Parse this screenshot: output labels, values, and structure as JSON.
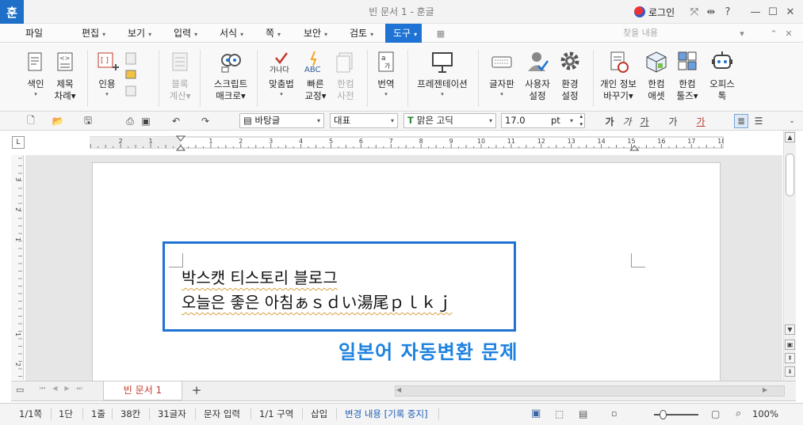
{
  "app": {
    "logo_text": "훈",
    "window_title": "빈 문서 1 - 훈글",
    "login_label": "로그인",
    "window_controls": [
      "minimize-icon",
      "maximize-icon",
      "close-icon"
    ]
  },
  "menu": {
    "items": [
      {
        "label": "파일",
        "dropdown": false
      },
      {
        "label": "편집",
        "dropdown": true
      },
      {
        "label": "보기",
        "dropdown": true
      },
      {
        "label": "입력",
        "dropdown": true
      },
      {
        "label": "서식",
        "dropdown": true
      },
      {
        "label": "쪽",
        "dropdown": true
      },
      {
        "label": "보안",
        "dropdown": true
      },
      {
        "label": "검토",
        "dropdown": true
      },
      {
        "label": "도구",
        "dropdown": true,
        "active": true
      }
    ],
    "find_placeholder": "찾을 내용"
  },
  "ribbon": {
    "buttons": [
      {
        "line1": "색인",
        "line2": "",
        "dropdown": true,
        "icon": "index-icon"
      },
      {
        "line1": "제목",
        "line2": "차례",
        "dropdown": true,
        "icon": "toc-icon"
      },
      {
        "line1": "인용",
        "line2": "",
        "dropdown": true,
        "icon": "citation-icon"
      },
      {
        "line1": "블록",
        "line2": "계산",
        "dropdown": true,
        "icon": "block-calc-icon",
        "disabled": true
      },
      {
        "line1": "스크립트",
        "line2": "매크로",
        "dropdown": true,
        "icon": "script-macro-icon"
      },
      {
        "line1": "맞춤법",
        "line2": "",
        "dropdown": true,
        "icon": "spellcheck-icon"
      },
      {
        "line1": "빠른",
        "line2": "교정",
        "dropdown": true,
        "icon": "quick-correct-icon"
      },
      {
        "line1": "한컴",
        "line2": "사전",
        "dropdown": false,
        "icon": "dictionary-icon",
        "disabled": true
      },
      {
        "line1": "번역",
        "line2": "",
        "dropdown": true,
        "icon": "translate-icon"
      },
      {
        "line1": "프레젠테이션",
        "line2": "",
        "dropdown": true,
        "icon": "presentation-icon"
      },
      {
        "line1": "글자판",
        "line2": "",
        "dropdown": true,
        "icon": "keyboard-icon"
      },
      {
        "line1": "사용자",
        "line2": "설정",
        "dropdown": false,
        "icon": "user-settings-icon"
      },
      {
        "line1": "환경",
        "line2": "설정",
        "dropdown": false,
        "icon": "preferences-icon"
      },
      {
        "line1": "개인 정보",
        "line2": "바꾸기",
        "dropdown": true,
        "icon": "privacy-icon"
      },
      {
        "line1": "한컴",
        "line2": "애셋",
        "dropdown": false,
        "icon": "hancom-asset-icon"
      },
      {
        "line1": "한컴",
        "line2": "툴즈",
        "dropdown": true,
        "icon": "hancom-tools-icon"
      },
      {
        "line1": "오피스",
        "line2": "톡",
        "dropdown": false,
        "icon": "office-talk-icon"
      }
    ],
    "spellcheck_icon_text": "가나다",
    "quick_correct_icon_text": "ABC"
  },
  "format": {
    "style": "바탕글",
    "language": "대표",
    "font": "맑은 고딕",
    "font_size": "17.0",
    "size_unit": "pt",
    "char_buttons": [
      "가",
      "가",
      "가",
      "가",
      "가"
    ]
  },
  "ruler": {
    "h_numbers": [
      "2",
      "1",
      "1",
      "2",
      "3",
      "4",
      "5",
      "6",
      "7",
      "8",
      "9",
      "10",
      "11",
      "12",
      "13",
      "14",
      "15",
      "16",
      "17",
      "18"
    ],
    "v_numbers": [
      "3",
      "2",
      "1",
      "1",
      "2"
    ]
  },
  "document": {
    "line1": "박스캣 티스토리 블로그",
    "line2": "오늘은 좋은 아침ぁｓｄい湯尾ｐｌｋｊ",
    "caption": "일본어 자동변환 문제",
    "highlight_color": "#1e73d4",
    "caption_color": "#1e82df"
  },
  "tabs": {
    "doc_tab": "빈 문서 1",
    "add_label": "+"
  },
  "status": {
    "page": "1/1쪽",
    "section": "1단",
    "line": "1줄",
    "column": "38칸",
    "chars": "31글자",
    "mode": "문자 입력",
    "area": "1/1 구역",
    "insert": "삽입",
    "track": "변경 내용 [기록 중지]",
    "zoom": "100%",
    "zoom_level": 0.2
  }
}
